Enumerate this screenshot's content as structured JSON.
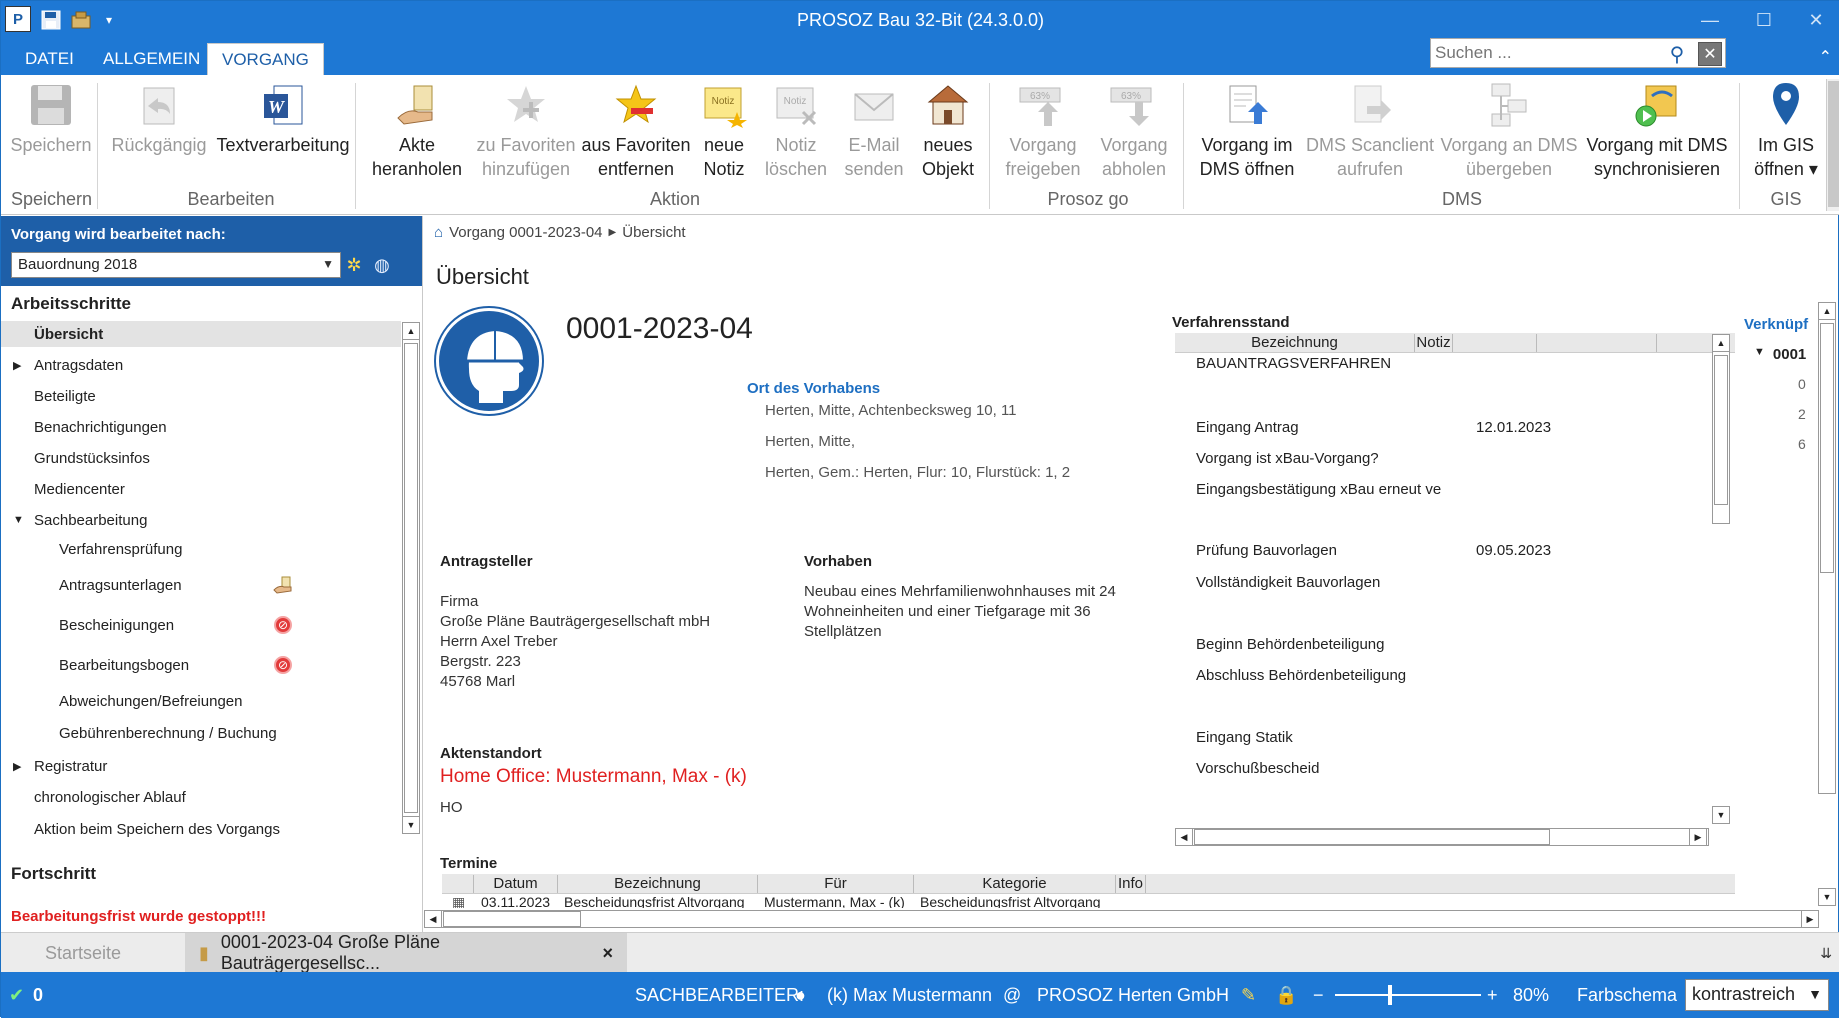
{
  "window": {
    "title": "PROSOZ Bau 32-Bit (24.3.0.0)",
    "app_icon_text": "P",
    "quick_access": [
      "save-icon",
      "package-icon",
      "dropdown-icon"
    ],
    "minimize": "—",
    "maximize": "☐",
    "close": "✕"
  },
  "ribbon_tabs": [
    {
      "label": "DATEI",
      "active": false
    },
    {
      "label": "ALLGEMEIN",
      "active": false
    },
    {
      "label": "VORGANG",
      "active": true
    }
  ],
  "search": {
    "placeholder": "Suchen ...",
    "value": ""
  },
  "ribbon": {
    "groups": [
      "Speichern",
      "Bearbeiten",
      "Aktion",
      "Prosoz go",
      "DMS",
      "GIS"
    ],
    "buttons": [
      {
        "label1": "Speichern",
        "label2": "",
        "icon": "floppy-icon",
        "enabled": false
      },
      {
        "label1": "Rückgängig",
        "label2": "",
        "icon": "undo-icon",
        "enabled": false
      },
      {
        "label1": "Textverarbeitung",
        "label2": "",
        "icon": "word-icon",
        "enabled": true
      },
      {
        "label1": "Akte",
        "label2": "heranholen",
        "icon": "hand-file-icon",
        "enabled": true
      },
      {
        "label1": "zu Favoriten",
        "label2": "hinzufügen",
        "icon": "star-add-icon",
        "enabled": false
      },
      {
        "label1": "aus Favoriten",
        "label2": "entfernen",
        "icon": "star-remove-icon",
        "enabled": true
      },
      {
        "label1": "neue",
        "label2": "Notiz",
        "icon": "note-add-icon",
        "enabled": true
      },
      {
        "label1": "Notiz",
        "label2": "löschen",
        "icon": "note-delete-icon",
        "enabled": false
      },
      {
        "label1": "E-Mail",
        "label2": "senden",
        "icon": "mail-icon",
        "enabled": false
      },
      {
        "label1": "neues",
        "label2": "Objekt",
        "icon": "house-icon",
        "enabled": true
      },
      {
        "label1": "Vorgang",
        "label2": "freigeben",
        "icon": "upload-progress-icon",
        "enabled": false,
        "badge": "63%"
      },
      {
        "label1": "Vorgang",
        "label2": "abholen",
        "icon": "download-progress-icon",
        "enabled": false,
        "badge": "63%"
      },
      {
        "label1": "Vorgang im",
        "label2": "DMS öffnen",
        "icon": "dms-open-icon",
        "enabled": true
      },
      {
        "label1": "DMS Scanclient",
        "label2": "aufrufen",
        "icon": "scan-icon",
        "enabled": false
      },
      {
        "label1": "Vorgang an DMS",
        "label2": "übergeben",
        "icon": "dms-transfer-icon",
        "enabled": false
      },
      {
        "label1": "Vorgang mit DMS",
        "label2": "synchronisieren",
        "icon": "sync-icon",
        "enabled": true
      },
      {
        "label1": "Im GIS",
        "label2": "öffnen ▾",
        "icon": "map-pin-icon",
        "enabled": true
      }
    ]
  },
  "left": {
    "header_label": "Vorgang wird bearbeitet nach:",
    "rule_select": "Bauordnung 2018",
    "section_steps": "Arbeitsschritte",
    "items": [
      {
        "label": "Übersicht",
        "selected": true,
        "tw": ""
      },
      {
        "label": "Antragsdaten",
        "tw": "▶"
      },
      {
        "label": "Beteiligte",
        "tw": ""
      },
      {
        "label": "Benachrichtigungen",
        "tw": ""
      },
      {
        "label": "Grundstücksinfos",
        "tw": ""
      },
      {
        "label": "Mediencenter",
        "tw": ""
      },
      {
        "label": "Sachbearbeitung",
        "tw": "▼"
      },
      {
        "label": "Verfahrensprüfung",
        "tw": ""
      },
      {
        "label": "Antragsunterlagen",
        "tw": ""
      },
      {
        "label": "Bescheinigungen",
        "tw": ""
      },
      {
        "label": "Bearbeitungsbogen",
        "tw": ""
      },
      {
        "label": "Abweichungen/Befreiungen",
        "tw": ""
      },
      {
        "label": "Gebührenberechnung / Buchung",
        "tw": ""
      },
      {
        "label": "Registratur",
        "tw": "▶"
      },
      {
        "label": "chronologischer Ablauf",
        "tw": ""
      },
      {
        "label": "Aktion beim Speichern des Vorgangs",
        "tw": ""
      }
    ],
    "section_progress": "Fortschritt",
    "progress_warning": "Bearbeitungsfrist wurde gestoppt!!!"
  },
  "main": {
    "breadcrumb": [
      "Vorgang 0001-2023-04",
      "Übersicht"
    ],
    "page_title": "Übersicht",
    "vorgang_nr": "0001-2023-04",
    "ort_heading": "Ort des Vorhabens",
    "ort_lines": [
      "Herten, Mitte, Achtenbecksweg 10, 11",
      "Herten, Mitte,",
      "Herten, Gem.: Herten, Flur: 10, Flurstück: 1, 2"
    ],
    "antragsteller_heading": "Antragsteller",
    "antragsteller_lines": [
      "Firma",
      "Große Pläne Bauträgergesellschaft mbH",
      "Herrn Axel Treber",
      "Bergstr. 223",
      "45768 Marl"
    ],
    "vorhaben_heading": "Vorhaben",
    "vorhaben_lines": [
      "Neubau eines Mehrfamilienwohnhauses mit 24",
      "Wohneinheiten und einer Tiefgarage mit 36",
      "Stellplätzen"
    ],
    "aktenstandort_heading": "Aktenstandort",
    "aktenstandort_value": "Home Office: Mustermann, Max - (k)",
    "aktenstandort_code": "HO",
    "verfahrensstand": {
      "title": "Verfahrensstand",
      "columns": [
        "Bezeichnung",
        "Notiz"
      ],
      "rows": [
        {
          "label": "BAUANTRAGSVERFAHREN",
          "date": "",
          "indent": false
        },
        {
          "label": "Eingang Antrag",
          "date": "12.01.2023",
          "indent": true
        },
        {
          "label": "Vorgang ist xBau-Vorgang?",
          "date": "",
          "indent": true
        },
        {
          "label": "Eingangsbestätigung xBau erneut ve",
          "date": "",
          "indent": true
        },
        {
          "label": "Prüfung  Bauvorlagen",
          "date": "09.05.2023",
          "indent": true
        },
        {
          "label": "Vollständigkeit Bauvorlagen",
          "date": "",
          "indent": true
        },
        {
          "label": "Beginn Behördenbeteiligung",
          "date": "",
          "indent": true
        },
        {
          "label": "Abschluss Behördenbeteiligung",
          "date": "",
          "indent": true
        },
        {
          "label": "Eingang Statik",
          "date": "",
          "indent": true
        },
        {
          "label": "Vorschußbescheid",
          "date": "",
          "indent": true
        }
      ]
    },
    "verknuepf": {
      "title": "Verknüpf",
      "root": "0001",
      "children": [
        "0",
        "2",
        "6"
      ]
    },
    "termine": {
      "title": "Termine",
      "columns": [
        "Datum",
        "Bezeichnung",
        "Für",
        "Kategorie",
        "Info"
      ],
      "rows": [
        {
          "datum": "03.11.2023",
          "bezeichnung": "Bescheidungsfrist Altvorgang",
          "fuer": "Mustermann, Max - (k)",
          "kategorie": "Bescheidungsfrist Altvorgang",
          "info": ""
        }
      ]
    }
  },
  "doc_tabs": [
    {
      "label": "Startseite",
      "active": false
    },
    {
      "label": "0001-2023-04 Große Pläne Bauträgergesellsc...",
      "active": true,
      "close": "×"
    }
  ],
  "status": {
    "count": "0",
    "sachbearbeiter_label": "SACHBEARBEITER:",
    "sachbearbeiter": "(k) Max Mustermann",
    "at": "@",
    "org": "PROSOZ Herten GmbH",
    "zoom_minus": "−",
    "zoom_plus": "+",
    "zoom": "80%",
    "zoom_level_fraction": 0.38,
    "farbschema_label": "Farbschema",
    "farbschema": "kontrastreich"
  },
  "colors": {
    "accent": "#1e78d4",
    "dark_accent": "#1e5fa8",
    "warning": "#e02020"
  }
}
